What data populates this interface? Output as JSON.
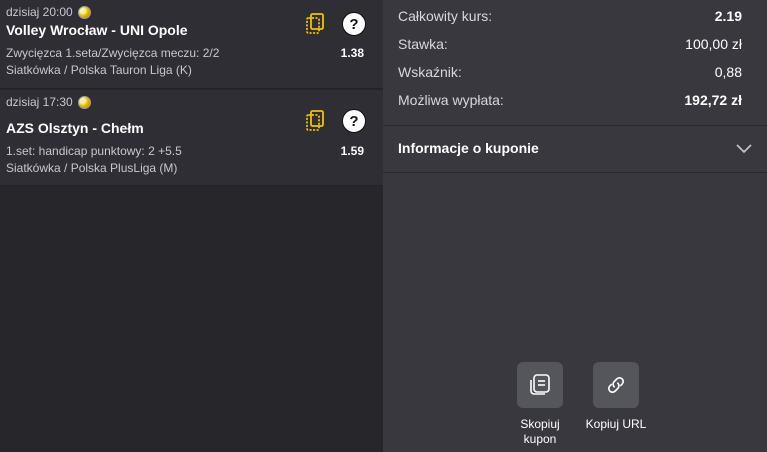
{
  "bets": [
    {
      "time": "dzisiaj 20:00",
      "match": "Volley Wrocław - UNI Opole",
      "market": "Zwycięzca 1.seta/Zwycięzca meczu: 2/2",
      "league": "Siatkówka / Polska Tauron Liga (K)",
      "odd": "1.38",
      "help": "?"
    },
    {
      "time": "dzisiaj 17:30",
      "match": "AZS Olsztyn - Chełm",
      "market": "1.set: handicap punktowy: 2 +5.5",
      "league": "Siatkówka / Polska PlusLiga (M)",
      "odd": "1.59",
      "help": "?"
    }
  ],
  "summary": {
    "total_odds_label": "Całkowity kurs:",
    "total_odds_value": "2.19",
    "stake_label": "Stawka:",
    "stake_value": "100,00 zł",
    "indicator_label": "Wskaźnik:",
    "indicator_value": "0,88",
    "payout_label": "Możliwa wypłata:",
    "payout_value": "192,72 zł"
  },
  "info": {
    "label": "Informacje o kuponie"
  },
  "actions": {
    "copy_coupon_line1": "Skopiuj",
    "copy_coupon_line2": "kupon",
    "copy_url": "Kopiuj URL"
  },
  "colors": {
    "accent": "#f2c200",
    "panel": "#38383e",
    "bet_bg": "#2e2e34"
  }
}
